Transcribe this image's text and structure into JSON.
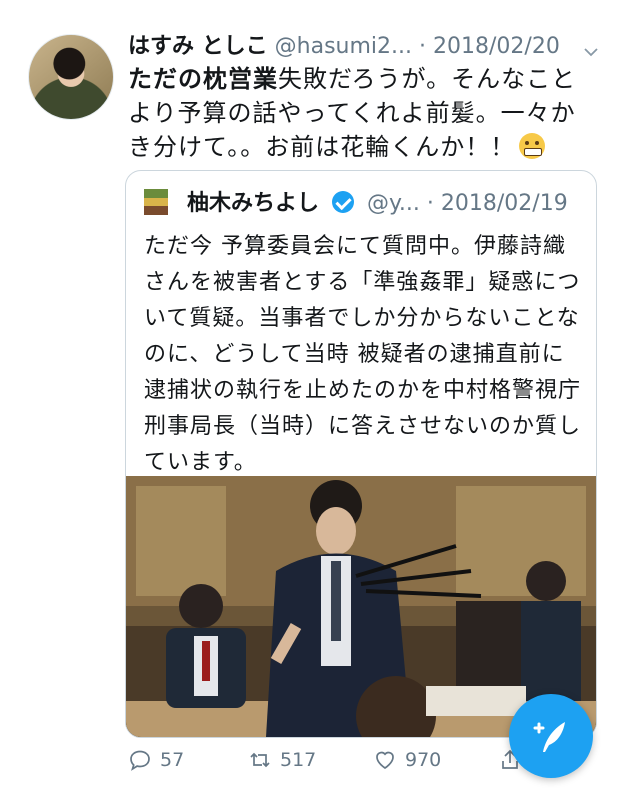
{
  "tweet": {
    "author_name": "はすみ としこ",
    "author_handle": "@hasumi2...",
    "separator": "·",
    "date": "2018/02/20",
    "body_bold": "ただの枕営業",
    "body_rest": "失敗だろうが。そんなことより予算の話やってくれよ前髪。一々かき分けて。。お前は花輪くんか！！",
    "emoji": "grimacing-face-emoji"
  },
  "quoted": {
    "author_name": "柚木みちよし",
    "author_handle": "@y...",
    "separator": "·",
    "date": "2018/02/19",
    "text": "ただ今 予算委員会にて質問中。伊藤詩織さんを被害者とする「準強姦罪」疑惑について質疑。当事者でしか分からないことなのに、どうして当時 被疑者の逮捕直前に逮捕状の執行を止めたのかを中村格警視庁刑事局長（当時）に答えさせないのか質しています。",
    "photo_description_icon": "parliament-photo"
  },
  "actions": {
    "replies": "57",
    "retweets": "517",
    "likes": "970"
  },
  "colors": {
    "accent": "#1da1f2",
    "muted": "#657786",
    "text": "#14171a",
    "border": "#ccd6dd"
  }
}
